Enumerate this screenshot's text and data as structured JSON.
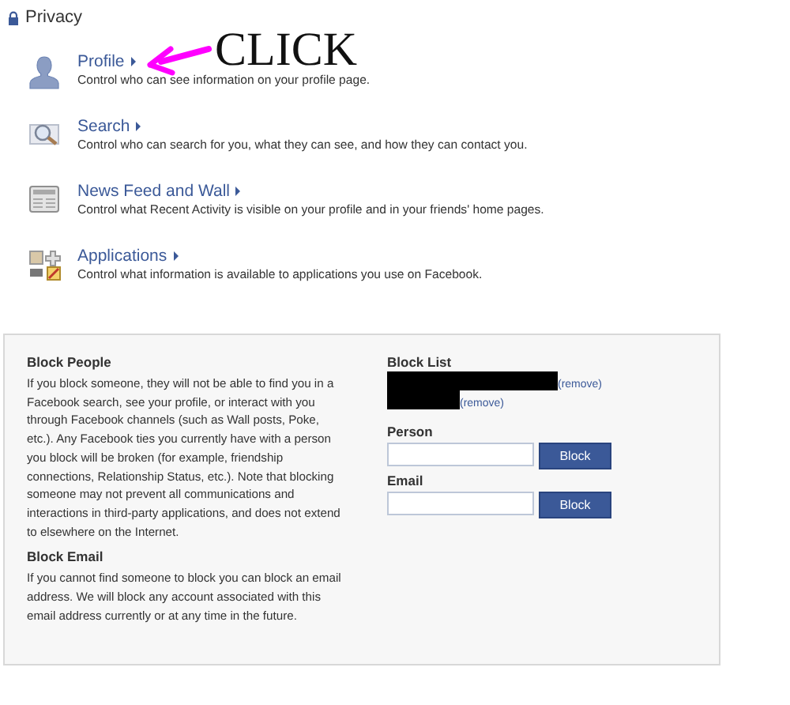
{
  "privacy": {
    "title": "Privacy",
    "items": [
      {
        "title": "Profile",
        "description": "Control who can see information on your profile page."
      },
      {
        "title": "Search",
        "description": "Control who can search for you, what they can see, and how they can contact you."
      },
      {
        "title": "News Feed and Wall",
        "description": "Control what Recent Activity is visible on your profile and in your friends' home pages."
      },
      {
        "title": "Applications",
        "description": "Control what information is available to applications you use on Facebook."
      }
    ]
  },
  "annotation": {
    "text": "CLICK"
  },
  "block_panel": {
    "sections": [
      {
        "heading": "Block People",
        "text": "If you block someone, they will not be able to find you in a Facebook search, see your profile, or interact with you through Facebook channels (such as Wall posts, Poke, etc.). Any Facebook ties you currently have with a person you block will be broken (for example, friendship connections, Relationship Status, etc.). Note that blocking someone may not prevent all communications and interactions in third-party applications, and does not extend to elsewhere on the Internet."
      },
      {
        "heading": "Block Email",
        "text": "If you cannot find someone to block you can block an email address. We will block any account associated with this email address currently or at any time in the future."
      }
    ],
    "block_list": {
      "label": "Block List",
      "entries": [
        {
          "remove": "(remove)"
        },
        {
          "remove": "(remove)"
        }
      ]
    },
    "fields": [
      {
        "label": "Person",
        "button": "Block"
      },
      {
        "label": "Email",
        "button": "Block"
      }
    ]
  }
}
